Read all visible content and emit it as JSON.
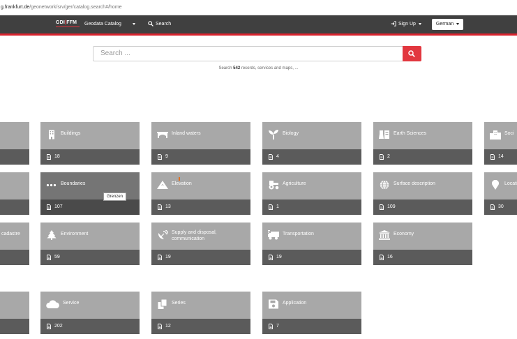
{
  "address_bar": {
    "host": "g.frankfurt.de",
    "path": "/geonetwork/srv/ger/catalog.search#/home"
  },
  "navbar": {
    "logo_text_left": "GDI",
    "logo_text_mid": "FFM",
    "catalog_label": "Geodata Catalog",
    "search_label": "Search",
    "signup_label": "Sign Up",
    "language_label": "German"
  },
  "search": {
    "placeholder": "Search ...",
    "hint_prefix": "Search",
    "hint_count": "542",
    "hint_suffix": "records, services and maps, ..."
  },
  "tooltip": "Grenzen",
  "tiles": {
    "row1": [
      {
        "label": "",
        "count": ""
      },
      {
        "label": "Buildings",
        "count": "18",
        "icon": "building-icon"
      },
      {
        "label": "Inland waters",
        "count": "9",
        "icon": "bridge-icon"
      },
      {
        "label": "Biology",
        "count": "4",
        "icon": "seedling-icon"
      },
      {
        "label": "Earth Sciences",
        "count": "2",
        "icon": "flask-icon"
      },
      {
        "label": "Soci",
        "count": "14",
        "icon": "city-icon"
      }
    ],
    "row2": [
      {
        "label": "",
        "count": ""
      },
      {
        "label": "Boundaries",
        "count": "107",
        "icon": "ellipsis-icon"
      },
      {
        "label": "Elevation",
        "count": "13",
        "icon": "mountain-icon"
      },
      {
        "label": "Agriculture",
        "count": "1",
        "icon": "tractor-icon"
      },
      {
        "label": "Surface description",
        "count": "109",
        "icon": "globe-icon"
      },
      {
        "label": "Locati",
        "count": "30",
        "icon": "map-marker-icon"
      }
    ],
    "row3": [
      {
        "label": "cadastre",
        "count": ""
      },
      {
        "label": "Environment",
        "count": "59",
        "icon": "tree-icon"
      },
      {
        "label": "Supply and disposal, communication",
        "count": "19",
        "icon": "satellite-dish-icon"
      },
      {
        "label": "Transportation",
        "count": "19",
        "icon": "truck-icon"
      },
      {
        "label": "Economy",
        "count": "16",
        "icon": "bank-icon"
      }
    ],
    "row4": [
      {
        "label": "",
        "count": ""
      },
      {
        "label": "Service",
        "count": "202",
        "icon": "cloud-icon"
      },
      {
        "label": "Series",
        "count": "12",
        "icon": "copy-icon"
      },
      {
        "label": "Application",
        "count": "7",
        "icon": "floppy-disk-icon"
      }
    ]
  },
  "colors": {
    "navbar_bg": "#404040",
    "accent_red": "#d9232e",
    "tile_top": "#a8a8a8",
    "tile_bottom": "#5b5b5b",
    "tile_hover_top": "#757575"
  }
}
